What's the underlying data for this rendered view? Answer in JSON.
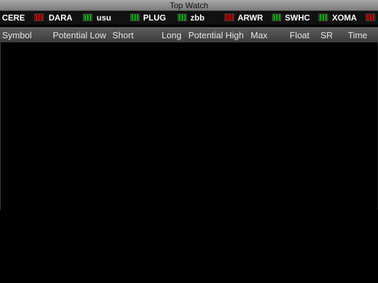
{
  "title": "Top Watch",
  "ticker": [
    {
      "symbol": "CERE",
      "status": "red"
    },
    {
      "symbol": "DARA",
      "status": "green"
    },
    {
      "symbol": "usu",
      "status": "green"
    },
    {
      "symbol": "PLUG",
      "status": "green"
    },
    {
      "symbol": "zbb",
      "status": "red"
    },
    {
      "symbol": "ARWR",
      "status": "green"
    },
    {
      "symbol": "SWHC",
      "status": "green"
    },
    {
      "symbol": "XOMA",
      "status": "red"
    }
  ],
  "columns": {
    "symbol": "Symbol",
    "potential_low": "Potential Low",
    "short": "Short",
    "long": "Long",
    "potential_high": "Potential High",
    "max": "Max",
    "float": "Float",
    "sr": "SR",
    "time": "Time"
  },
  "colors": {
    "background": "#000000",
    "status_red": "#e01010",
    "status_green": "#28d028"
  }
}
